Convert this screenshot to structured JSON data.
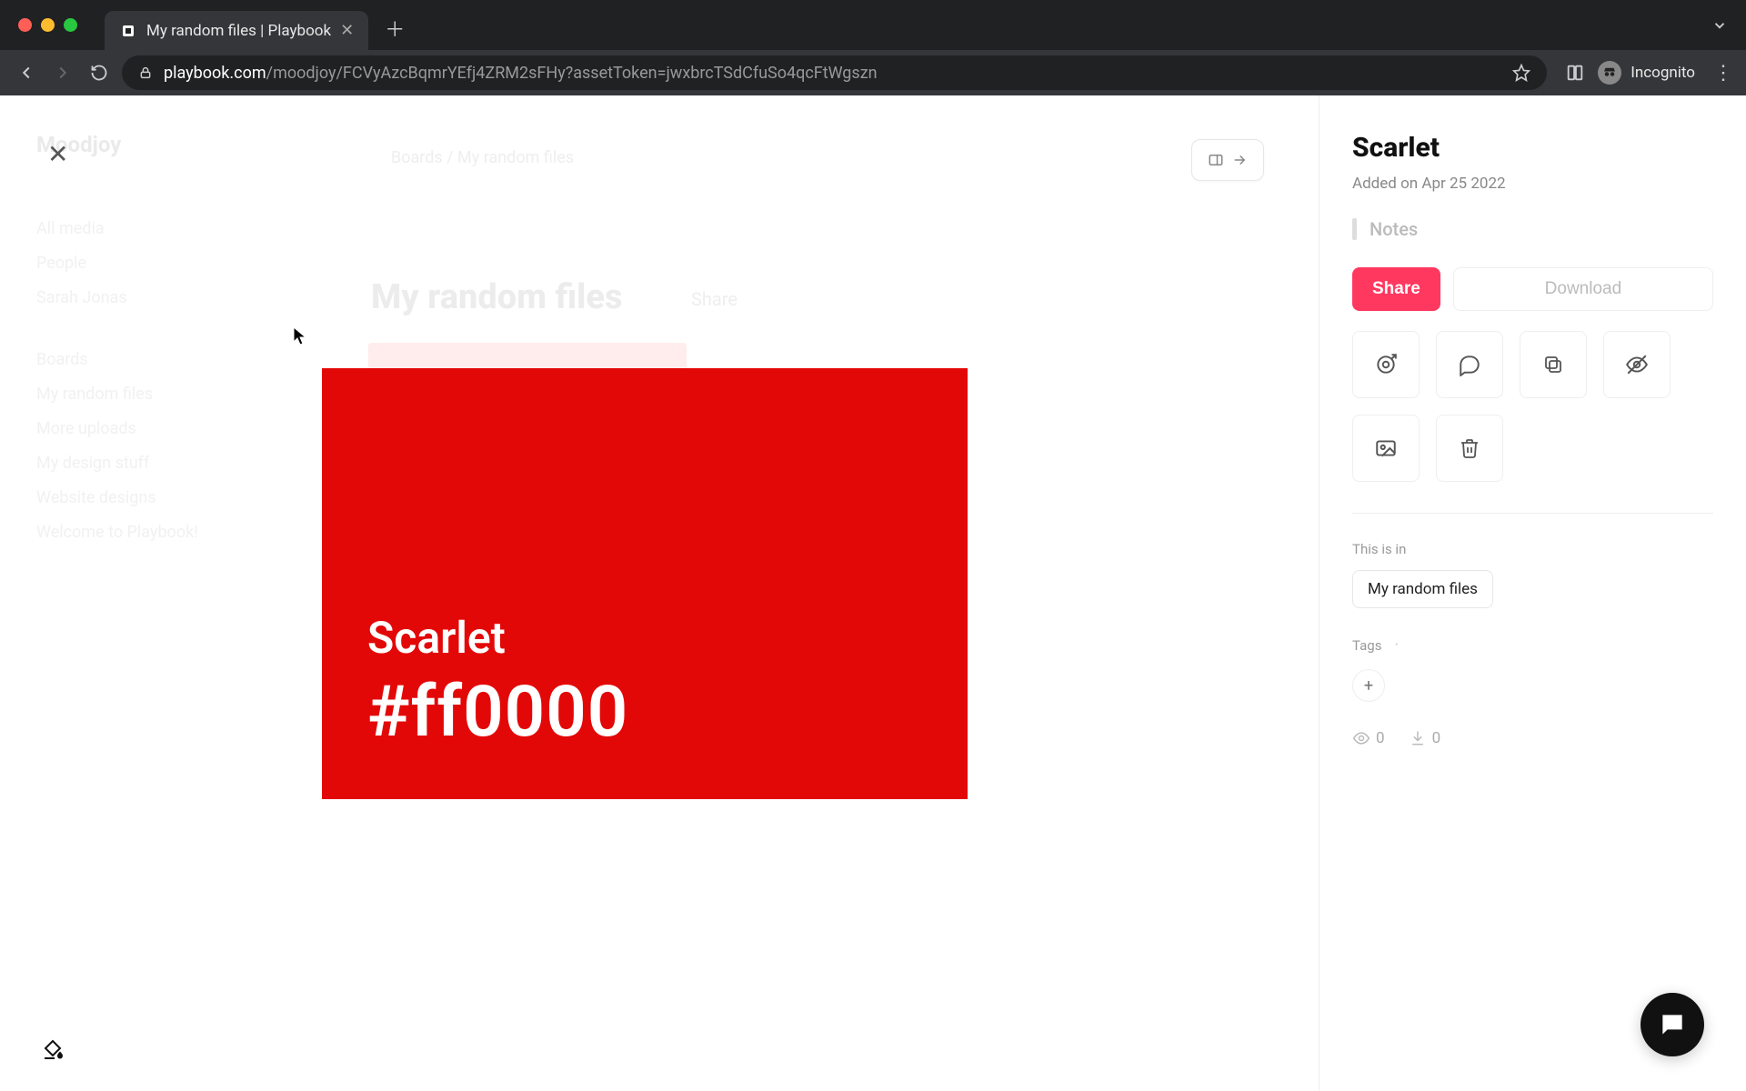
{
  "browser": {
    "tab_title": "My random files | Playbook",
    "url_domain": "playbook.com",
    "url_path": "/moodjoy/FCVyAzcBqmrYEfj4ZRM2sFHy?assetToken=jwxbrcTSdCfuSo4qcFtWgszn",
    "incognito_label": "Incognito"
  },
  "background": {
    "workspace_name": "Moodjoy",
    "sidebar_items": [
      "All media",
      "People",
      "Sarah Jonas"
    ],
    "boards_label": "Boards",
    "boards": [
      "My random files",
      "More uploads",
      "My design stuff",
      "Website designs",
      "Welcome to Playbook!"
    ],
    "main_title": "My random files",
    "share_label": "Share",
    "breadcrumb": "Boards / My random files"
  },
  "asset": {
    "name": "Scarlet",
    "hex": "#ff0000",
    "swatch_bg": "#e30808"
  },
  "detail": {
    "title": "Scarlet",
    "added_prefix": "Added on",
    "added_date": "Apr 25 2022",
    "notes_label": "Notes",
    "share_label": "Share",
    "download_label": "Download",
    "this_is_in_label": "This is in",
    "folder": "My random files",
    "tags_label": "Tags",
    "views_count": "0",
    "downloads_count": "0",
    "add_tag_label": "+"
  },
  "icons": {
    "target": "target-icon",
    "comment": "comment-icon",
    "copy": "copy-icon",
    "hide": "hide-icon",
    "image": "image-icon",
    "trash": "trash-icon"
  }
}
